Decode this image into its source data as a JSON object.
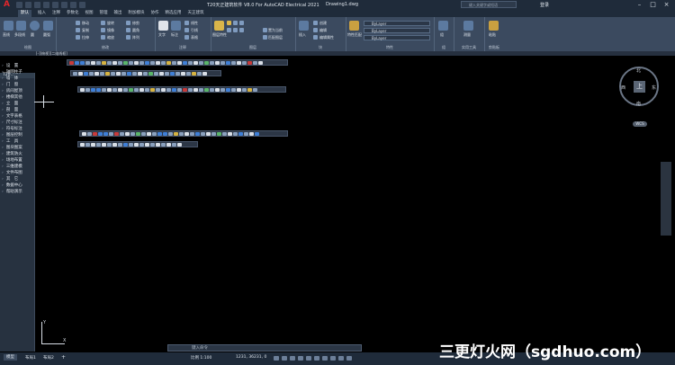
{
  "app": {
    "title": "T20天正建筑软件 V8.0 For AutoCAD Electrical 2021",
    "drawing": "Drawing1.dwg",
    "search_placeholder": "键入关键字或短语",
    "user": "登录"
  },
  "tabs": [
    "默认",
    "插入",
    "注释",
    "参数化",
    "视图",
    "管理",
    "输出",
    "附加模块",
    "协作",
    "精选应用",
    "天正建筑"
  ],
  "ribbon": {
    "panels": [
      "绘图",
      "修改",
      "注释",
      "图层",
      "块",
      "特性",
      "组",
      "实用工具",
      "剪贴板"
    ],
    "draw_tools": [
      "直线",
      "多段线",
      "圆",
      "圆弧"
    ],
    "modify_tools": [
      "移动",
      "旋转",
      "修剪",
      "复制",
      "镜像",
      "圆角",
      "拉伸",
      "缩放",
      "阵列"
    ],
    "annot_tools": [
      "文字",
      "标注",
      "线性",
      "引线",
      "表格"
    ],
    "layer_tools": [
      "图层特性",
      "置为当前",
      "匹配图层"
    ],
    "block_tools": [
      "插入",
      "创建",
      "编辑",
      "编辑属性"
    ],
    "prop_tools": [
      "特性匹配"
    ],
    "layer_value": "ByLayer",
    "linetype_value": "ByLayer",
    "lineweight_value": "ByLayer",
    "group_tool": "组",
    "util_tool": "测量",
    "clip_tool": "粘贴"
  },
  "file_tab": "[-][俯视][二维线框]",
  "palette": {
    "title": "T20...",
    "items": [
      "设　置",
      "轴网柱子",
      "墙　体",
      "门　窗",
      "房间屋顶",
      "楼梯其他",
      "立　面",
      "剖　面",
      "文字表格",
      "尺寸标注",
      "符号标注",
      "图层控制",
      "工　具",
      "图块图案",
      "建筑防火",
      "场地布置",
      "三维建模",
      "文件布图",
      "其　它",
      "数据中心",
      "帮助演示"
    ]
  },
  "viewcube": {
    "face": "上",
    "north": "北",
    "south": "南",
    "east": "东",
    "west": "西",
    "wcs": "WCS"
  },
  "ucs": {
    "x": "X",
    "y": "Y"
  },
  "command": {
    "placeholder": "键入命令"
  },
  "status": {
    "model_tab": "模型",
    "layout1": "布局1",
    "layout2": "布局2",
    "scale": "比例 1:100",
    "coords": "1231, 36231, 0"
  },
  "watermark": "三更灯火网（sgdhuo.com）"
}
